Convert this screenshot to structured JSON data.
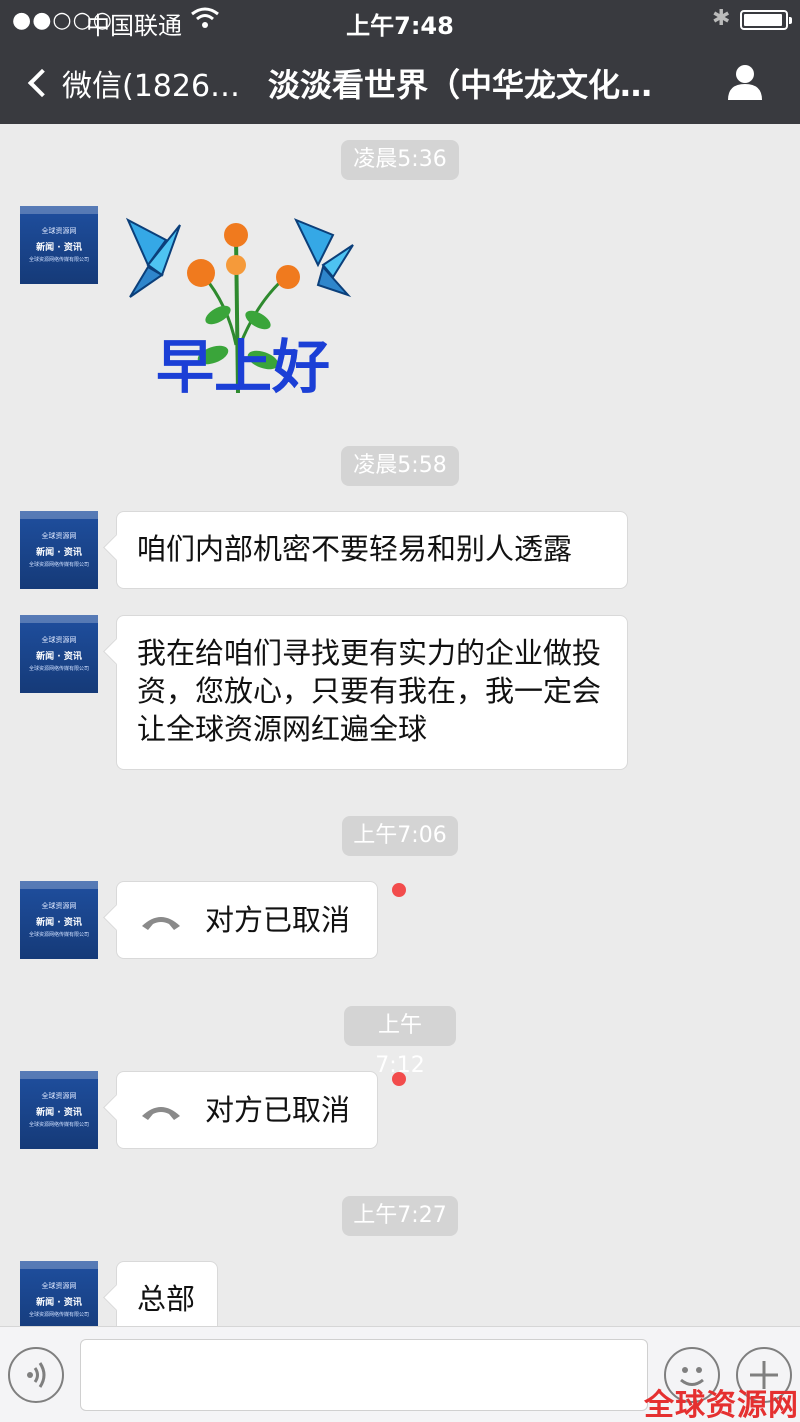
{
  "status_bar": {
    "signal": "●●○○○",
    "carrier": "中国联通",
    "time": "上午7:48"
  },
  "nav": {
    "back_label": "微信(1826…",
    "title": "淡淡看世界（中华龙文化…"
  },
  "avatar": {
    "line1": "全球资源网",
    "line2": "新闻 · 资讯",
    "line3": "全球资源网络传媒有限公司"
  },
  "sticker": {
    "text": "早上好"
  },
  "messages": {
    "t1": "凌晨5:36",
    "t2": "凌晨5:58",
    "m1": "咱们内部机密不要轻易和别人透露",
    "m2": "我在给咱们寻找更有实力的企业做投资，您放心，只要有我在，我一定会让全球资源网红遍全球",
    "t3": "上午7:06",
    "call1": "对方已取消",
    "t4": "上午7:12",
    "call2": "对方已取消",
    "t5": "上午7:27",
    "m3": "总部"
  },
  "watermark": "全球资源网",
  "colors": {
    "nav_bg": "#393a3f",
    "chat_bg": "#ebebeb",
    "unread_dot": "#f24c4c",
    "watermark": "#e53030"
  }
}
